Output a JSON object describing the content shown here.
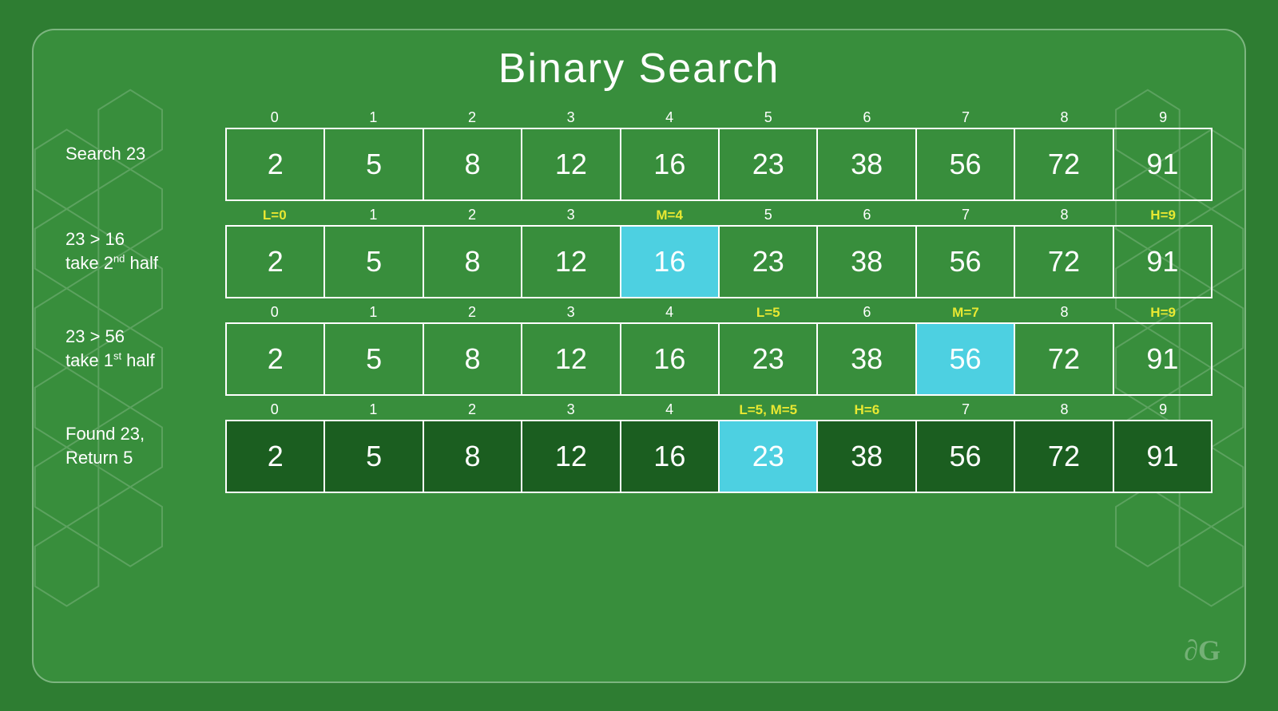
{
  "title": "Binary Search",
  "logo": "∂G",
  "rows": [
    {
      "id": "row1",
      "label": "Search 23",
      "labelHtml": "Search 23",
      "indices": [
        {
          "text": "0",
          "class": ""
        },
        {
          "text": "1",
          "class": ""
        },
        {
          "text": "2",
          "class": ""
        },
        {
          "text": "3",
          "class": ""
        },
        {
          "text": "4",
          "class": ""
        },
        {
          "text": "5",
          "class": ""
        },
        {
          "text": "6",
          "class": ""
        },
        {
          "text": "7",
          "class": ""
        },
        {
          "text": "8",
          "class": ""
        },
        {
          "text": "9",
          "class": ""
        }
      ],
      "values": [
        2,
        5,
        8,
        12,
        16,
        23,
        38,
        56,
        72,
        91
      ],
      "highlight": -1
    },
    {
      "id": "row2",
      "label": "23 > 16\ntake 2nd half",
      "indices": [
        {
          "text": "L=0",
          "class": "yellow"
        },
        {
          "text": "1",
          "class": ""
        },
        {
          "text": "2",
          "class": ""
        },
        {
          "text": "3",
          "class": ""
        },
        {
          "text": "M=4",
          "class": "yellow"
        },
        {
          "text": "5",
          "class": ""
        },
        {
          "text": "6",
          "class": ""
        },
        {
          "text": "7",
          "class": ""
        },
        {
          "text": "8",
          "class": ""
        },
        {
          "text": "H=9",
          "class": "yellow"
        }
      ],
      "values": [
        2,
        5,
        8,
        12,
        16,
        23,
        38,
        56,
        72,
        91
      ],
      "highlight": 4
    },
    {
      "id": "row3",
      "label": "23 > 56\ntake 1st half",
      "indices": [
        {
          "text": "0",
          "class": ""
        },
        {
          "text": "1",
          "class": ""
        },
        {
          "text": "2",
          "class": ""
        },
        {
          "text": "3",
          "class": ""
        },
        {
          "text": "4",
          "class": ""
        },
        {
          "text": "L=5",
          "class": "yellow"
        },
        {
          "text": "6",
          "class": ""
        },
        {
          "text": "M=7",
          "class": "yellow"
        },
        {
          "text": "8",
          "class": ""
        },
        {
          "text": "H=9",
          "class": "yellow"
        }
      ],
      "values": [
        2,
        5,
        8,
        12,
        16,
        23,
        38,
        56,
        72,
        91
      ],
      "highlight": 7
    },
    {
      "id": "row4",
      "label": "Found 23,\nReturn 5",
      "indices": [
        {
          "text": "0",
          "class": ""
        },
        {
          "text": "1",
          "class": ""
        },
        {
          "text": "2",
          "class": ""
        },
        {
          "text": "3",
          "class": ""
        },
        {
          "text": "4",
          "class": ""
        },
        {
          "text": "L=5, M=5",
          "class": "yellow"
        },
        {
          "text": "H=6",
          "class": "yellow"
        },
        {
          "text": "7",
          "class": ""
        },
        {
          "text": "8",
          "class": ""
        },
        {
          "text": "9",
          "class": ""
        }
      ],
      "values": [
        2,
        5,
        8,
        12,
        16,
        23,
        38,
        56,
        72,
        91
      ],
      "highlight": 5
    }
  ]
}
